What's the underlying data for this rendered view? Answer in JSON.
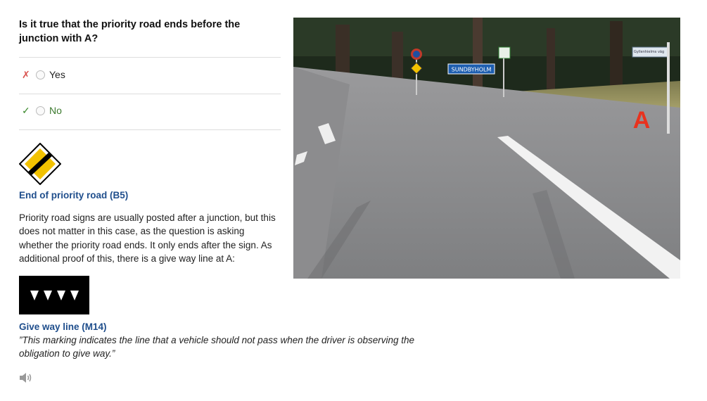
{
  "question": "Is it true that the priority road ends before the junction with A?",
  "options": [
    {
      "mark": "✗",
      "label": "Yes"
    },
    {
      "mark": "✓",
      "label": "No"
    }
  ],
  "explanation": {
    "sign_caption": "End of priority road (B5)",
    "text": "Priority road signs are usually posted after a junction, but this does not matter in this case, as the question is asking whether the priority road ends. It only ends after the sign. As additional proof of this, there is a give way line at A:",
    "marking_caption": "Give way line (M14)",
    "marking_quote": "”This marking indicates the line that a vehicle should not pass when the driver is observing the obligation to give way.”"
  },
  "photo": {
    "town_sign": "SUNDBYHOLM",
    "street_sign": "Gyllenhielms väg",
    "junction_label": "A"
  },
  "icons": {
    "wrong": "x-mark-icon",
    "right": "check-mark-icon",
    "audio": "speaker-icon"
  },
  "colors": {
    "wrong": "#d9534f",
    "right": "#3c8a2e",
    "caption": "#1f4e8c",
    "junction_label": "#e8321e"
  }
}
